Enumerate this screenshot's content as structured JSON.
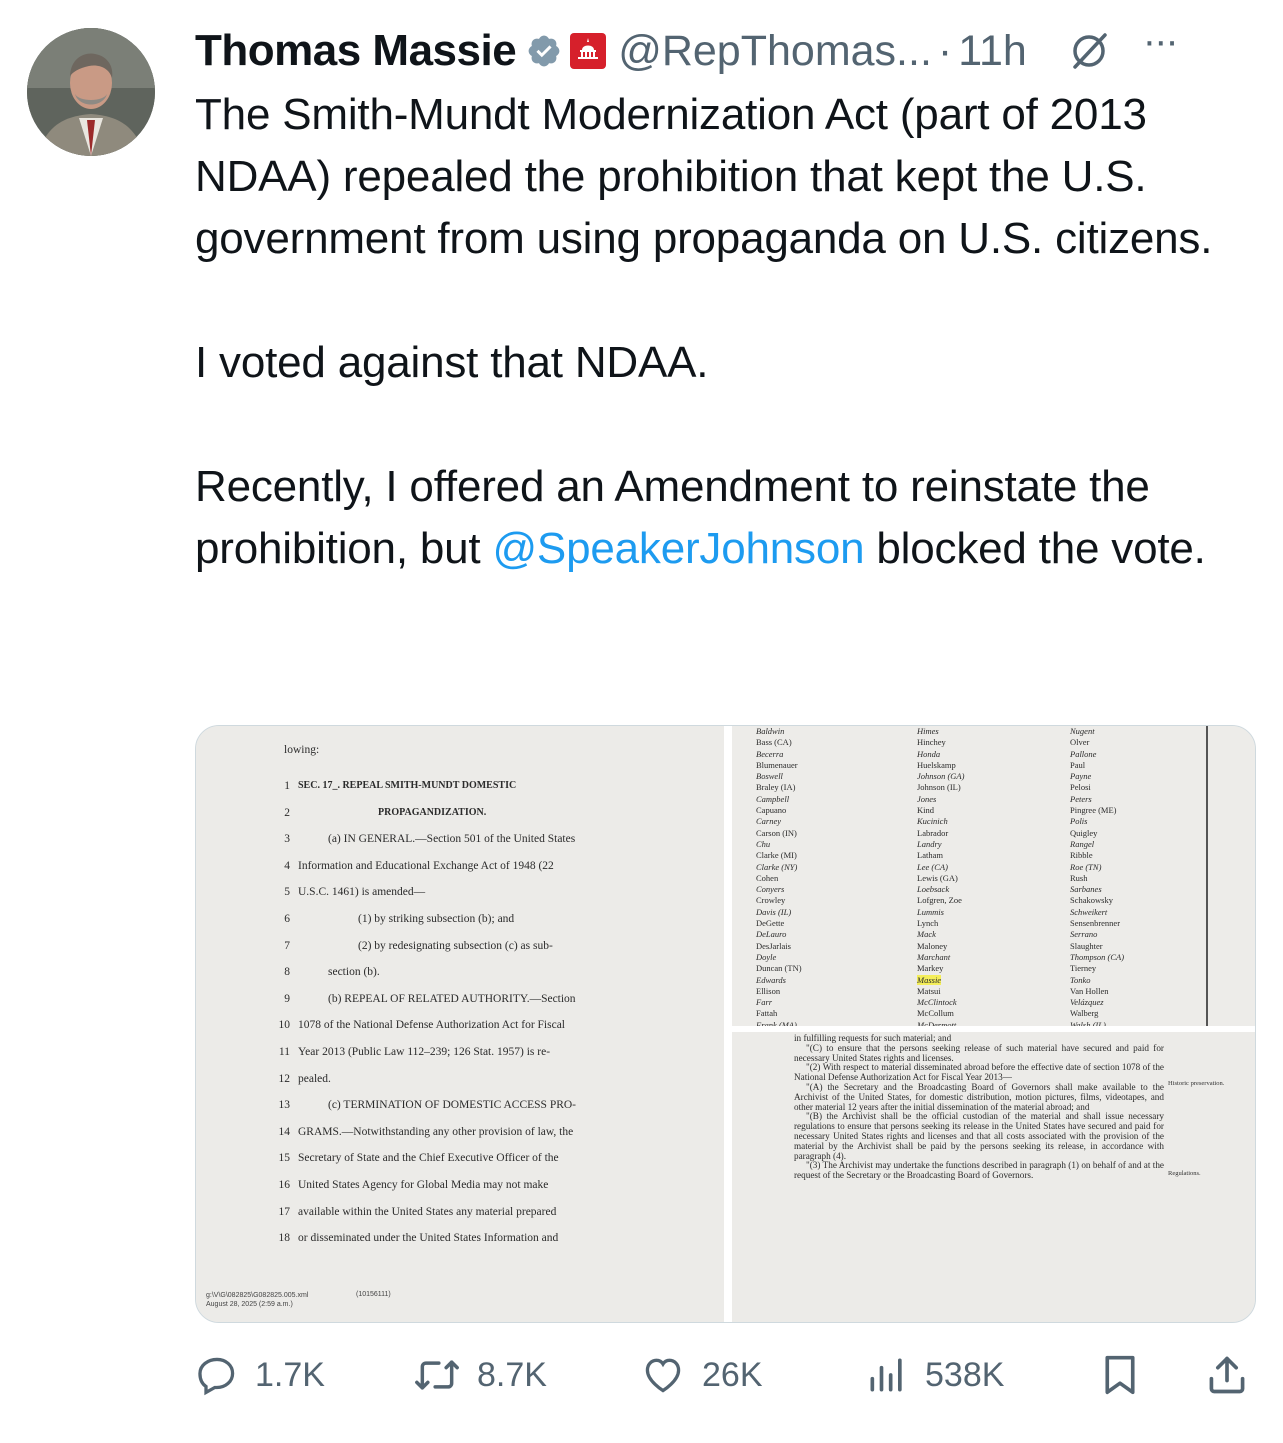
{
  "author": {
    "name": "Thomas Massie",
    "handle": "@RepThomas...",
    "separator": "·",
    "time": "11h",
    "badge_text": "HOUSE GOP"
  },
  "tweet": {
    "paragraph1": "The Smith-Mundt Modernization Act (part of 2013 NDAA) repealed the prohibition that kept the U.S. government from using propaganda on U.S. citizens.",
    "paragraph2": "I voted against that NDAA.",
    "paragraph3_before": "Recently, I offered an Amendment to reinstate the prohibition, but ",
    "paragraph3_mention": "@SpeakerJohnson",
    "paragraph3_after": " blocked the vote."
  },
  "media": {
    "bill_preamble": "lowing:",
    "bill_lines": [
      {
        "n": "1",
        "t": "SEC.   17_.   REPEAL   SMITH-MUNDT   DOMESTIC"
      },
      {
        "n": "2",
        "t": "PROPAGANDIZATION."
      },
      {
        "n": "3",
        "t": "(a) IN GENERAL.—Section 501 of the United States"
      },
      {
        "n": "4",
        "t": "Information and Educational Exchange Act of 1948 (22"
      },
      {
        "n": "5",
        "t": "U.S.C. 1461) is amended—"
      },
      {
        "n": "6",
        "t": "(1) by striking subsection (b); and"
      },
      {
        "n": "7",
        "t": "(2)  by  redesignating  subsection  (c)  as  sub-"
      },
      {
        "n": "8",
        "t": "section (b)."
      },
      {
        "n": "9",
        "t": "(b) REPEAL  OF  RELATED  AUTHORITY.—Section"
      },
      {
        "n": "10",
        "t": "1078 of the National Defense Authorization Act for Fiscal"
      },
      {
        "n": "11",
        "t": "Year 2013 (Public Law 112–239; 126 Stat. 1957) is re-"
      },
      {
        "n": "12",
        "t": "pealed."
      },
      {
        "n": "13",
        "t": "(c)  TERMINATION  OF  DOMESTIC  ACCESS  PRO-"
      },
      {
        "n": "14",
        "t": "GRAMS.—Notwithstanding any other provision of law, the"
      },
      {
        "n": "15",
        "t": "Secretary of State and the Chief Executive Officer of the"
      },
      {
        "n": "16",
        "t": "United States Agency for Global Media may not make"
      },
      {
        "n": "17",
        "t": "available within the United States any material prepared"
      },
      {
        "n": "18",
        "t": "or disseminated under the United States Information and"
      }
    ],
    "bill_footer_line1": "g:\\V\\G\\082825\\G082825.005.xml",
    "bill_footer_line2": "August 28, 2025 (2:59 a.m.)",
    "bill_footer_code": "(10156111)",
    "vote_col1": [
      "Baldwin",
      "Bass (CA)",
      "Becerra",
      "Blumenauer",
      "Boswell",
      "Braley (IA)",
      "Campbell",
      "Capuano",
      "Carney",
      "Carson (IN)",
      "Chu",
      "Clarke (MI)",
      "Clarke (NY)",
      "Cohen",
      "Conyers",
      "Crowley",
      "Davis (IL)",
      "DeGette",
      "DeLauro",
      "DesJarlais",
      "Doyle",
      "Duncan (TN)",
      "Edwards",
      "Ellison",
      "Farr",
      "Fattah",
      "Frank (MA)"
    ],
    "vote_col2": [
      "Himes",
      "Hinchey",
      "Honda",
      "Huelskamp",
      "Johnson (GA)",
      "Johnson (IL)",
      "Jones",
      "Kind",
      "Kucinich",
      "Labrador",
      "Landry",
      "Latham",
      "Lee (CA)",
      "Lewis (GA)",
      "Loebsack",
      "Lofgren, Zoe",
      "Lummis",
      "Lynch",
      "Mack",
      "Maloney",
      "Marchant",
      "Markey",
      "Massie",
      "Matsui",
      "McClintock",
      "McCollum",
      "McDermott"
    ],
    "vote_col3": [
      "Nugent",
      "Olver",
      "Pallone",
      "Paul",
      "Payne",
      "Pelosi",
      "Peters",
      "Pingree (ME)",
      "Polis",
      "Quigley",
      "Rangel",
      "Ribble",
      "Roe (TN)",
      "Rush",
      "Sarbanes",
      "Schakowsky",
      "Schweikert",
      "Sensenbrenner",
      "Serrano",
      "Slaughter",
      "Thompson (CA)",
      "Tierney",
      "Tonko",
      "Van Hollen",
      "Velázquez",
      "Walberg",
      "Walsh (IL)"
    ],
    "vote_highlight": "Massie",
    "law_text": [
      "in fulfilling requests for such material; and",
      "\"(C) to ensure that the persons seeking release of such material have secured and paid for necessary United States rights and licenses.",
      "\"(2) With respect to material disseminated abroad before the effective date of section 1078 of the National Defense Authorization Act for Fiscal Year 2013—",
      "\"(A) the Secretary and the Broadcasting Board of Governors shall make available to the Archivist of the United States, for domestic distribution, motion pictures, films, videotapes, and other material 12 years after the initial dissemination of the material abroad; and",
      "\"(B) the Archivist shall be the official custodian of the material and shall issue necessary regulations to ensure that persons seeking its release in the United States have secured and paid for necessary United States rights and licenses and that all costs associated with the provision of the material by the Archivist shall be paid by the persons seeking its release, in accordance with paragraph (4).",
      "\"(3) The Archivist may undertake the functions described in paragraph (1) on behalf of and at the request of the Secretary or the Broadcasting Board of Governors."
    ],
    "law_note1": "Historic preservation.",
    "law_note2": "Regulations."
  },
  "actions": {
    "replies": "1.7K",
    "reposts": "8.7K",
    "likes": "26K",
    "views": "538K"
  },
  "icons": [
    "verified-icon",
    "house-gop-badge-icon",
    "grok-icon",
    "more-icon",
    "reply-icon",
    "repost-icon",
    "like-icon",
    "views-icon",
    "bookmark-icon",
    "share-icon"
  ],
  "colors": {
    "text": "#0f1419",
    "secondary": "#536471",
    "mention": "#1d9bf0",
    "verified": "#829aab",
    "gop_badge": "#d6202b",
    "highlight": "#f4ee5a"
  }
}
